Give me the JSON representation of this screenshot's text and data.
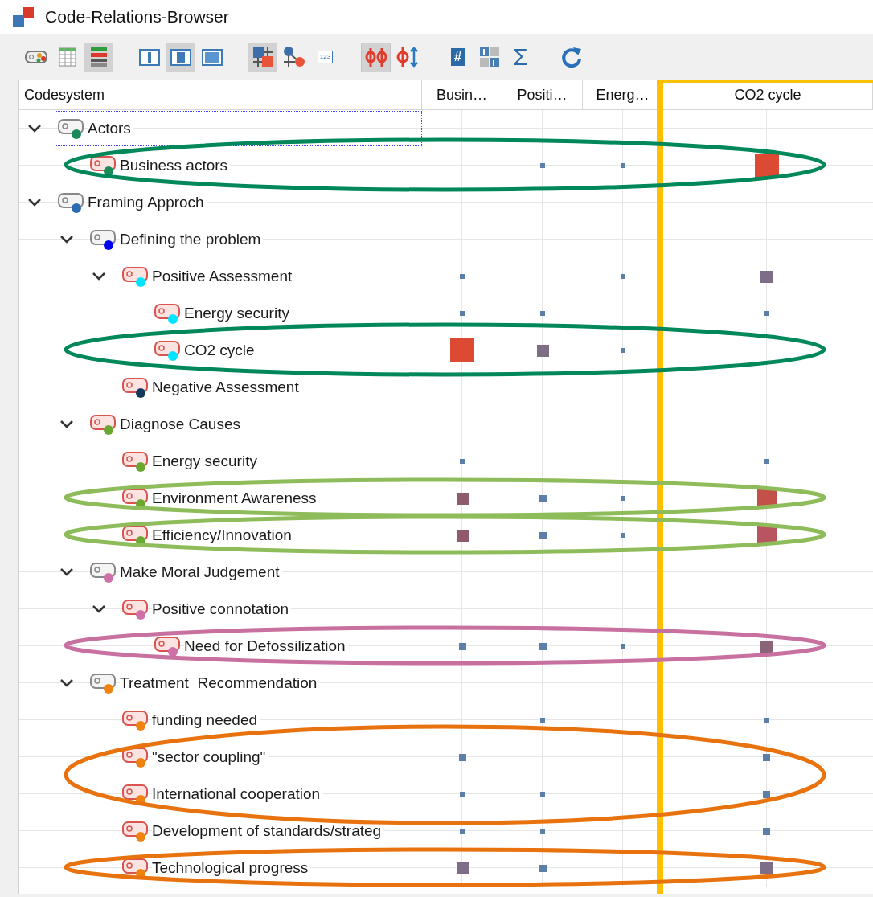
{
  "window": {
    "title": "Code-Relations-Browser"
  },
  "toolbar": [
    [
      {
        "kind": "code-tag",
        "pressed": false
      },
      {
        "kind": "grid",
        "pressed": false
      },
      {
        "kind": "stripes",
        "pressed": true
      }
    ],
    [
      {
        "kind": "panel-left",
        "pressed": false
      },
      {
        "kind": "panel-mid",
        "pressed": true
      },
      {
        "kind": "panel-full",
        "pressed": false
      }
    ],
    [
      {
        "kind": "squares",
        "pressed": true
      },
      {
        "kind": "nodes",
        "pressed": false
      },
      {
        "kind": "number-box",
        "pressed": false,
        "text": "123"
      }
    ],
    [
      {
        "kind": "phi-pair",
        "pressed": true
      },
      {
        "kind": "phi-arrows",
        "pressed": false
      }
    ],
    [
      {
        "kind": "hash-doc",
        "pressed": false,
        "text": "#"
      },
      {
        "kind": "ones-grid",
        "pressed": false
      },
      {
        "kind": "sigma",
        "pressed": false,
        "text": "Σ"
      }
    ],
    [
      {
        "kind": "refresh",
        "pressed": false
      }
    ]
  ],
  "columns": [
    {
      "label": "Codesystem",
      "highlighted": false
    },
    {
      "label": "Busin…",
      "highlighted": false
    },
    {
      "label": "Positi…",
      "highlighted": false
    },
    {
      "label": "Energ…",
      "highlighted": false
    },
    {
      "label": "CO2 cycle",
      "highlighted": true
    }
  ],
  "tree": [
    {
      "label": "Actors",
      "kind": "category",
      "color": "#1a8a5a",
      "expanded": true,
      "focused": true,
      "children": [
        {
          "label": "Business actors",
          "kind": "code",
          "color": "#1a8a5a",
          "focused": false,
          "cells": [
            null,
            {
              "kind": "tiny",
              "color": "#5b7fa6"
            },
            {
              "kind": "tiny",
              "color": "#5b7fa6"
            },
            {
              "kind": "huge",
              "color": "#dc4a33"
            }
          ],
          "ring": {
            "color": "#00875a",
            "kind": "tall"
          }
        }
      ]
    },
    {
      "label": "Framing Approch",
      "kind": "category",
      "color": "#2b6cb0",
      "expanded": true,
      "focused": false,
      "children": [
        {
          "label": "Defining the problem",
          "kind": "category",
          "color": "#0000ee",
          "expanded": true,
          "focused": false,
          "children": [
            {
              "label": "Positive Assessment",
              "kind": "code",
              "color": "#00e5ff",
              "expanded": true,
              "focused": false,
              "cells": [
                {
                  "kind": "tiny",
                  "color": "#5b7fa6"
                },
                null,
                {
                  "kind": "tiny",
                  "color": "#5b7fa6"
                },
                {
                  "kind": "medium",
                  "color": "#7e6d87"
                }
              ],
              "children": [
                {
                  "label": "Energy security",
                  "kind": "code",
                  "color": "#00e5ff",
                  "focused": false,
                  "cells": [
                    {
                      "kind": "tiny",
                      "color": "#5b7fa6"
                    },
                    {
                      "kind": "tiny",
                      "color": "#5b7fa6"
                    },
                    null,
                    {
                      "kind": "tiny",
                      "color": "#5b7fa6"
                    }
                  ]
                },
                {
                  "label": "CO2 cycle",
                  "kind": "code",
                  "color": "#00e5ff",
                  "focused": false,
                  "cells": [
                    {
                      "kind": "huge",
                      "color": "#dc4a33"
                    },
                    {
                      "kind": "medium",
                      "color": "#7e6d87"
                    },
                    {
                      "kind": "tiny",
                      "color": "#5b7fa6"
                    },
                    null
                  ],
                  "ring": {
                    "color": "#00875a",
                    "kind": "tall"
                  }
                }
              ]
            },
            {
              "label": "Negative Assessment",
              "kind": "code",
              "color": "#123a5a",
              "focused": false
            }
          ]
        },
        {
          "label": "Diagnose Causes",
          "kind": "code",
          "color": "#6aa832",
          "expanded": true,
          "focused": false,
          "children": [
            {
              "label": "Energy security",
              "kind": "code",
              "color": "#6aa832",
              "focused": false,
              "cells": [
                {
                  "kind": "tiny",
                  "color": "#5b7fa6"
                },
                null,
                null,
                {
                  "kind": "tiny",
                  "color": "#5b7fa6"
                }
              ]
            },
            {
              "label": "Environment Awareness",
              "kind": "code",
              "color": "#6aa832",
              "focused": false,
              "cells": [
                {
                  "kind": "medium",
                  "color": "#8e5b6c"
                },
                {
                  "kind": "small",
                  "color": "#5b7fa6"
                },
                {
                  "kind": "tiny",
                  "color": "#5b7fa6"
                },
                {
                  "kind": "large",
                  "color": "#c4504a"
                }
              ],
              "ring": {
                "color": "#8fbc5a",
                "kind": "flat"
              }
            },
            {
              "label": "Efficiency/Innovation",
              "kind": "code",
              "color": "#6aa832",
              "focused": false,
              "cells": [
                {
                  "kind": "medium",
                  "color": "#8e5b6c"
                },
                {
                  "kind": "small",
                  "color": "#5b7fa6"
                },
                {
                  "kind": "tiny",
                  "color": "#5b7fa6"
                },
                {
                  "kind": "large",
                  "color": "#b85560"
                }
              ],
              "ring": {
                "color": "#8fbc5a",
                "kind": "flat"
              }
            }
          ]
        },
        {
          "label": "Make Moral Judgement",
          "kind": "category",
          "color": "#d070a8",
          "expanded": true,
          "focused": false,
          "children": [
            {
              "label": "Positive connotation",
              "kind": "code",
              "color": "#d070a8",
              "expanded": true,
              "focused": false,
              "children": [
                {
                  "label": "Need for Defossilization",
                  "kind": "code",
                  "color": "#d070a8",
                  "focused": false,
                  "cells": [
                    {
                      "kind": "small",
                      "color": "#5b7fa6"
                    },
                    {
                      "kind": "small",
                      "color": "#5b7fa6"
                    },
                    {
                      "kind": "tiny",
                      "color": "#5b7fa6"
                    },
                    {
                      "kind": "medium",
                      "color": "#8a6478"
                    }
                  ],
                  "ring": {
                    "color": "#c8709f",
                    "kind": "flat"
                  }
                }
              ]
            }
          ]
        },
        {
          "label": "Treatment  Recommendation",
          "kind": "category",
          "color": "#f0820f",
          "expanded": true,
          "focused": false,
          "children": [
            {
              "label": "funding needed",
              "kind": "code",
              "color": "#f0820f",
              "focused": false,
              "cells": [
                null,
                {
                  "kind": "tiny",
                  "color": "#5b7fa6"
                },
                null,
                {
                  "kind": "tiny",
                  "color": "#5b7fa6"
                }
              ]
            },
            {
              "label": "\"sector coupling\"",
              "kind": "code",
              "color": "#f0820f",
              "focused": false,
              "cells": [
                {
                  "kind": "small",
                  "color": "#5b7fa6"
                },
                null,
                null,
                {
                  "kind": "small",
                  "color": "#5b7fa6"
                }
              ],
              "ring": {
                "color": "#e8730e",
                "kind": "double"
              }
            },
            {
              "label": "International cooperation",
              "kind": "code",
              "color": "#f0820f",
              "focused": false,
              "cells": [
                {
                  "kind": "tiny",
                  "color": "#5b7fa6"
                },
                {
                  "kind": "tiny",
                  "color": "#5b7fa6"
                },
                null,
                {
                  "kind": "small",
                  "color": "#5b7fa6"
                }
              ]
            },
            {
              "label": "Development of standards/strateg",
              "kind": "code",
              "color": "#f0820f",
              "focused": false,
              "cells": [
                {
                  "kind": "tiny",
                  "color": "#5b7fa6"
                },
                {
                  "kind": "tiny",
                  "color": "#5b7fa6"
                },
                null,
                {
                  "kind": "small",
                  "color": "#5b7fa6"
                }
              ]
            },
            {
              "label": "Technological progress",
              "kind": "code",
              "color": "#f0820f",
              "focused": false,
              "cells": [
                {
                  "kind": "medium",
                  "color": "#7e6d87"
                },
                {
                  "kind": "small",
                  "color": "#5b7fa6"
                },
                null,
                {
                  "kind": "medium",
                  "color": "#7e6d87"
                }
              ],
              "ring": {
                "color": "#e8730e",
                "kind": "flat"
              }
            }
          ]
        }
      ]
    }
  ]
}
